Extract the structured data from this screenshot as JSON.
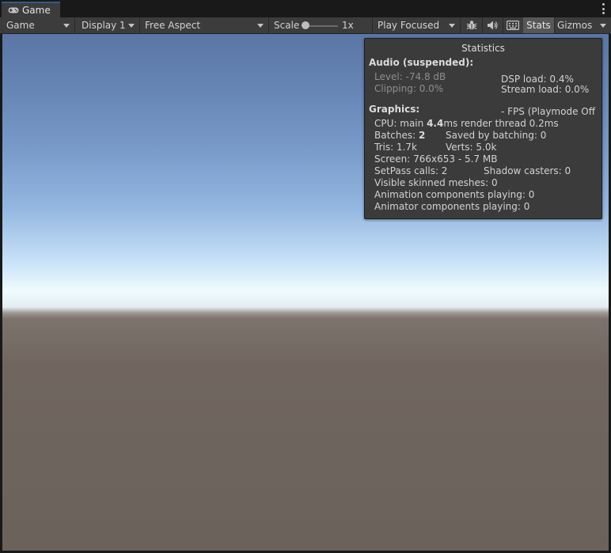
{
  "tab": {
    "label": "Game",
    "icon": "gamepad-icon"
  },
  "toolbar": {
    "mode_dropdown": "Game",
    "display_dropdown": "Display 1",
    "aspect_dropdown": "Free Aspect",
    "scale_label": "Scale",
    "scale_value": "1x",
    "play_mode_dropdown": "Play Focused",
    "stats_button": "Stats",
    "gizmos_button": "Gizmos",
    "icons": [
      "bug-icon",
      "audio-icon",
      "keyboard-icon"
    ]
  },
  "statistics": {
    "title": "Statistics",
    "audio_heading": "Audio (suspended):",
    "audio_level": "Level: -74.8 dB",
    "audio_clipping": "Clipping: 0.0%",
    "dsp_load": "DSP load: 0.4%",
    "stream_load": "Stream load: 0.0%",
    "graphics_heading": "Graphics:",
    "fps": "- FPS (Playmode Off",
    "cpu_prefix": "CPU: main ",
    "cpu_main": "4.4",
    "cpu_suffix": "ms  render thread 0.2ms",
    "batches_prefix": "Batches: ",
    "batches": "2",
    "saved_by_batching": "Saved by batching: 0",
    "tris": "Tris: 1.7k",
    "verts": "Verts: 5.0k",
    "screen": "Screen: 766x653 - 5.7 MB",
    "setpass": "SetPass calls: 2",
    "shadow_casters": "Shadow casters: 0",
    "skinned_meshes": "Visible skinned meshes: 0",
    "animation_components": "Animation components playing: 0",
    "animator_components": "Animator components playing: 0"
  }
}
